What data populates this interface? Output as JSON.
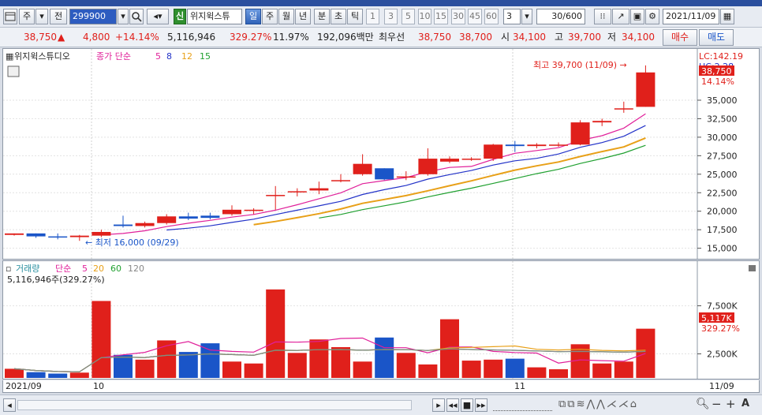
{
  "toolbar": {
    "menu_icon": "window-menu-icon",
    "type_label": "주",
    "prev_label": "전",
    "code": "299900",
    "new_badge": "신",
    "stock_name": "위지윅스튜",
    "periods": [
      "일",
      "주",
      "월",
      "년",
      "분",
      "초",
      "틱"
    ],
    "active_period": "일",
    "intervals": [
      "1",
      "3",
      "5",
      "10",
      "15",
      "30",
      "45",
      "60"
    ],
    "count_select": "3",
    "view_count": "30",
    "total_count": "/600",
    "date": "2021/11/09"
  },
  "quote": {
    "price": "38,750",
    "up_mark": "▲",
    "change": "4,800",
    "change_pct": "+14.14%",
    "volume": "5,116,946",
    "volume_pct": "329.27%",
    "turnover": "11.97%",
    "value": "192,096백만",
    "priority_label": "최우선",
    "ask": "38,750",
    "bid": "38,700",
    "open_label": "시",
    "open": "34,100",
    "high_label": "고",
    "high": "39,700",
    "low_label": "저",
    "low": "34,100",
    "buy_label": "매수",
    "sell_label": "매도"
  },
  "price_panel": {
    "stock_label": "위지윅스튜디오",
    "indicator_label": "종가 단순",
    "ma": [
      "5",
      "8",
      "12",
      "15"
    ],
    "ma_colors": [
      "#e0209a",
      "#2333c8",
      "#e8a018",
      "#20a030"
    ],
    "lc_label": "LC:142.19",
    "hc_label": "HC:2.28",
    "last_price_tag": "38,750",
    "pct_tag": "14.14%",
    "high_annotation": "최고 39,700 (11/09) →",
    "low_annotation": "← 최저 16,000 (09/29)",
    "y_ticks": [
      "35,000",
      "32,500",
      "30,000",
      "27,500",
      "25,000",
      "22,500",
      "20,000",
      "17,500",
      "15,000"
    ],
    "y_min": 14000,
    "y_max": 41500
  },
  "volume_panel": {
    "title": "거래량",
    "indicator_label": "단순",
    "ma": [
      "5",
      "20",
      "60",
      "120"
    ],
    "ma_colors": [
      "#e0209a",
      "#e8a018",
      "#20a030",
      "#888888"
    ],
    "value_text": "5,116,946주(329.27%)",
    "y_ticks": [
      "7,500K",
      "2,500K"
    ],
    "vol_tag": "5,117K",
    "vol_pct_tag": "329.27%",
    "y_max": 10500000
  },
  "x_axis": {
    "labels": [
      "2021/09",
      "10",
      "11",
      "11/09"
    ]
  },
  "chart_data": {
    "type": "candlestick",
    "x": [
      "09/28",
      "09/29",
      "09/30",
      "10/01",
      "10/05",
      "10/06",
      "10/07",
      "10/08",
      "10/12",
      "10/13",
      "10/14",
      "10/15",
      "10/18",
      "10/19",
      "10/20",
      "10/21",
      "10/22",
      "10/25",
      "10/26",
      "10/27",
      "10/28",
      "10/29",
      "11/01",
      "11/02",
      "11/03",
      "11/04",
      "11/05",
      "11/08",
      "11/09",
      "11/10"
    ],
    "open": [
      16800,
      17000,
      16600,
      16500,
      16700,
      18200,
      18000,
      18400,
      19300,
      19400,
      19600,
      20200,
      22200,
      22700,
      22800,
      24200,
      25000,
      25800,
      24700,
      25000,
      26700,
      27100,
      27100,
      29000,
      28800,
      29000,
      29000,
      32000,
      33900,
      34100
    ],
    "close": [
      17000,
      16600,
      16500,
      16700,
      17200,
      18000,
      18400,
      19300,
      19000,
      19100,
      20200,
      20200,
      22200,
      22700,
      23100,
      24200,
      26400,
      24300,
      24700,
      27100,
      27100,
      27100,
      29000,
      28800,
      29000,
      29000,
      32000,
      32200,
      33900,
      38750
    ],
    "high": [
      17000,
      17000,
      17000,
      16800,
      17500,
      19400,
      18600,
      19600,
      19800,
      19800,
      20800,
      20400,
      23400,
      23100,
      24000,
      25000,
      27700,
      25800,
      25400,
      28500,
      27400,
      27300,
      29100,
      29500,
      29200,
      29300,
      32300,
      32500,
      34800,
      39700
    ],
    "low": [
      16700,
      16400,
      16200,
      16000,
      16500,
      17800,
      17800,
      18200,
      18800,
      18900,
      19400,
      19600,
      20200,
      22000,
      22300,
      23900,
      24800,
      24200,
      24200,
      24800,
      26500,
      26800,
      26800,
      28000,
      28500,
      28700,
      28900,
      31500,
      33300,
      34100
    ],
    "volume": [
      950000,
      600000,
      450000,
      550000,
      8000000,
      2400000,
      1900000,
      3900000,
      2700000,
      3600000,
      1700000,
      1500000,
      9200000,
      2600000,
      4000000,
      3200000,
      1700000,
      4200000,
      2600000,
      1400000,
      6100000,
      1800000,
      1900000,
      2000000,
      1100000,
      900000,
      3500000,
      1500000,
      1700000,
      5116946
    ],
    "series_colors": {
      "up": "#e0201b",
      "down": "#1a55c8"
    }
  }
}
